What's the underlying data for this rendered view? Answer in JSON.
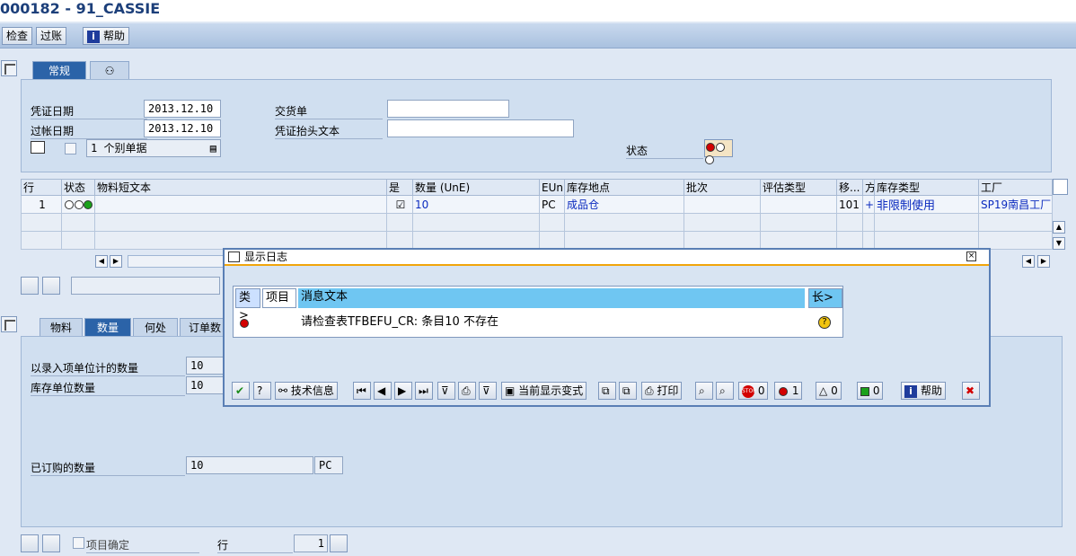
{
  "title": "000182 - 91_CASSIE",
  "toolbar": {
    "check": "检查",
    "post": "过账",
    "help": "帮助"
  },
  "header_tabs": [
    "常规"
  ],
  "header": {
    "doc_date_label": "凭证日期",
    "doc_date": "2013.12.10",
    "post_date_label": "过帐日期",
    "post_date": "2013.12.10",
    "delivery_label": "交货单",
    "delivery": "",
    "header_text_label": "凭证抬头文本",
    "header_text": "",
    "slip_option": "1 个别单据",
    "status_label": "状态"
  },
  "grid": {
    "columns": [
      "行",
      "状态",
      "物料短文本",
      "是",
      "数量 (UnE)",
      "EUn",
      "库存地点",
      "批次",
      "评估类型",
      "移...",
      "方",
      "库存类型",
      "工厂"
    ],
    "rows": [
      {
        "line": "1",
        "desc": "",
        "qty": "10",
        "eun": "PC",
        "sloc": "成品仓",
        "batch": "",
        "val": "",
        "mvt": "101",
        "dir": "+",
        "stock": "非限制使用",
        "plant": "SP19南昌工厂"
      }
    ]
  },
  "item_tabs": [
    "物料",
    "数量",
    "何处",
    "订单数"
  ],
  "item": {
    "qty_entry_label": "以录入项单位计的数量",
    "qty_entry": "10",
    "qty_stock_label": "库存单位数量",
    "qty_stock": "10",
    "qty_ordered_label": "已订购的数量",
    "qty_ordered": "10",
    "qty_ordered_unit": "PC"
  },
  "footer": {
    "item_ok_label": "项目确定",
    "line_label": "行",
    "line_value": "1"
  },
  "dialog": {
    "title": "显示日志",
    "col_type": "类>",
    "col_item": "项目",
    "col_msg": "消息文本",
    "col_len": "长>",
    "message": "请检查表TFBEFU_CR: 条目10  不存在",
    "buttons": {
      "tech": "技术信息",
      "variant": "当前显示变式",
      "print": "打印",
      "stop_count": "0",
      "err_count": "1",
      "warn_count": "0",
      "ok_count": "0",
      "help": "帮助"
    }
  }
}
